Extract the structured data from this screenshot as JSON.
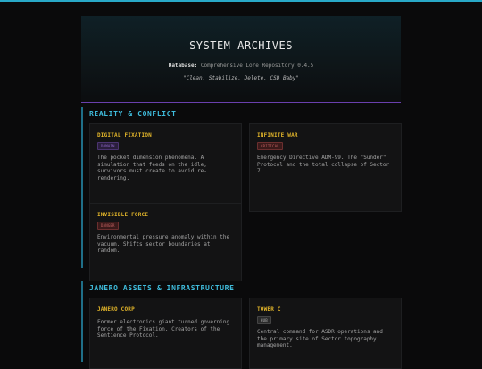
{
  "header": {
    "title": "SYSTEM ARCHIVES",
    "db_label": "Database:",
    "db_value": "Comprehensive Lore Repository 0.4.5",
    "quote": "\"Clean, Stabilize, Delete, CSD Baby\""
  },
  "sections": [
    {
      "title": "REALITY & CONFLICT",
      "cards": [
        {
          "title": "DIGITAL FIXATION",
          "badge": "DOMAIN",
          "desc": "The pocket dimension phenomena. A simulation that feeds on the idle; survivors must create to avoid re-rendering."
        },
        {
          "title": "INFINITE WAR",
          "badge": "CRITICAL",
          "desc": "Emergency Directive ADM-99. The \"Sunder\" Protocol and the total collapse of Sector 7."
        },
        {
          "title": "INVISIBLE FORCE",
          "badge": "DANGER",
          "desc": "Environmental pressure anomaly within the vacuum. Shifts sector boundaries at random."
        }
      ]
    },
    {
      "title": "JANERO ASSETS & INFRASTRUCTURE",
      "cards": [
        {
          "title": "JANERO CORP",
          "badge": "",
          "desc": "Former electronics giant turned governing force of the Fixation. Creators of the Sentience Protocol."
        },
        {
          "title": "TOWER C",
          "badge": "HUB",
          "desc": "Central command for ASDR operations and the primary site of Sector topography management."
        }
      ]
    }
  ],
  "colors": {
    "accent": "#3fbcdc",
    "card_title": "#e2b52a",
    "divider": "#6a3fae"
  }
}
